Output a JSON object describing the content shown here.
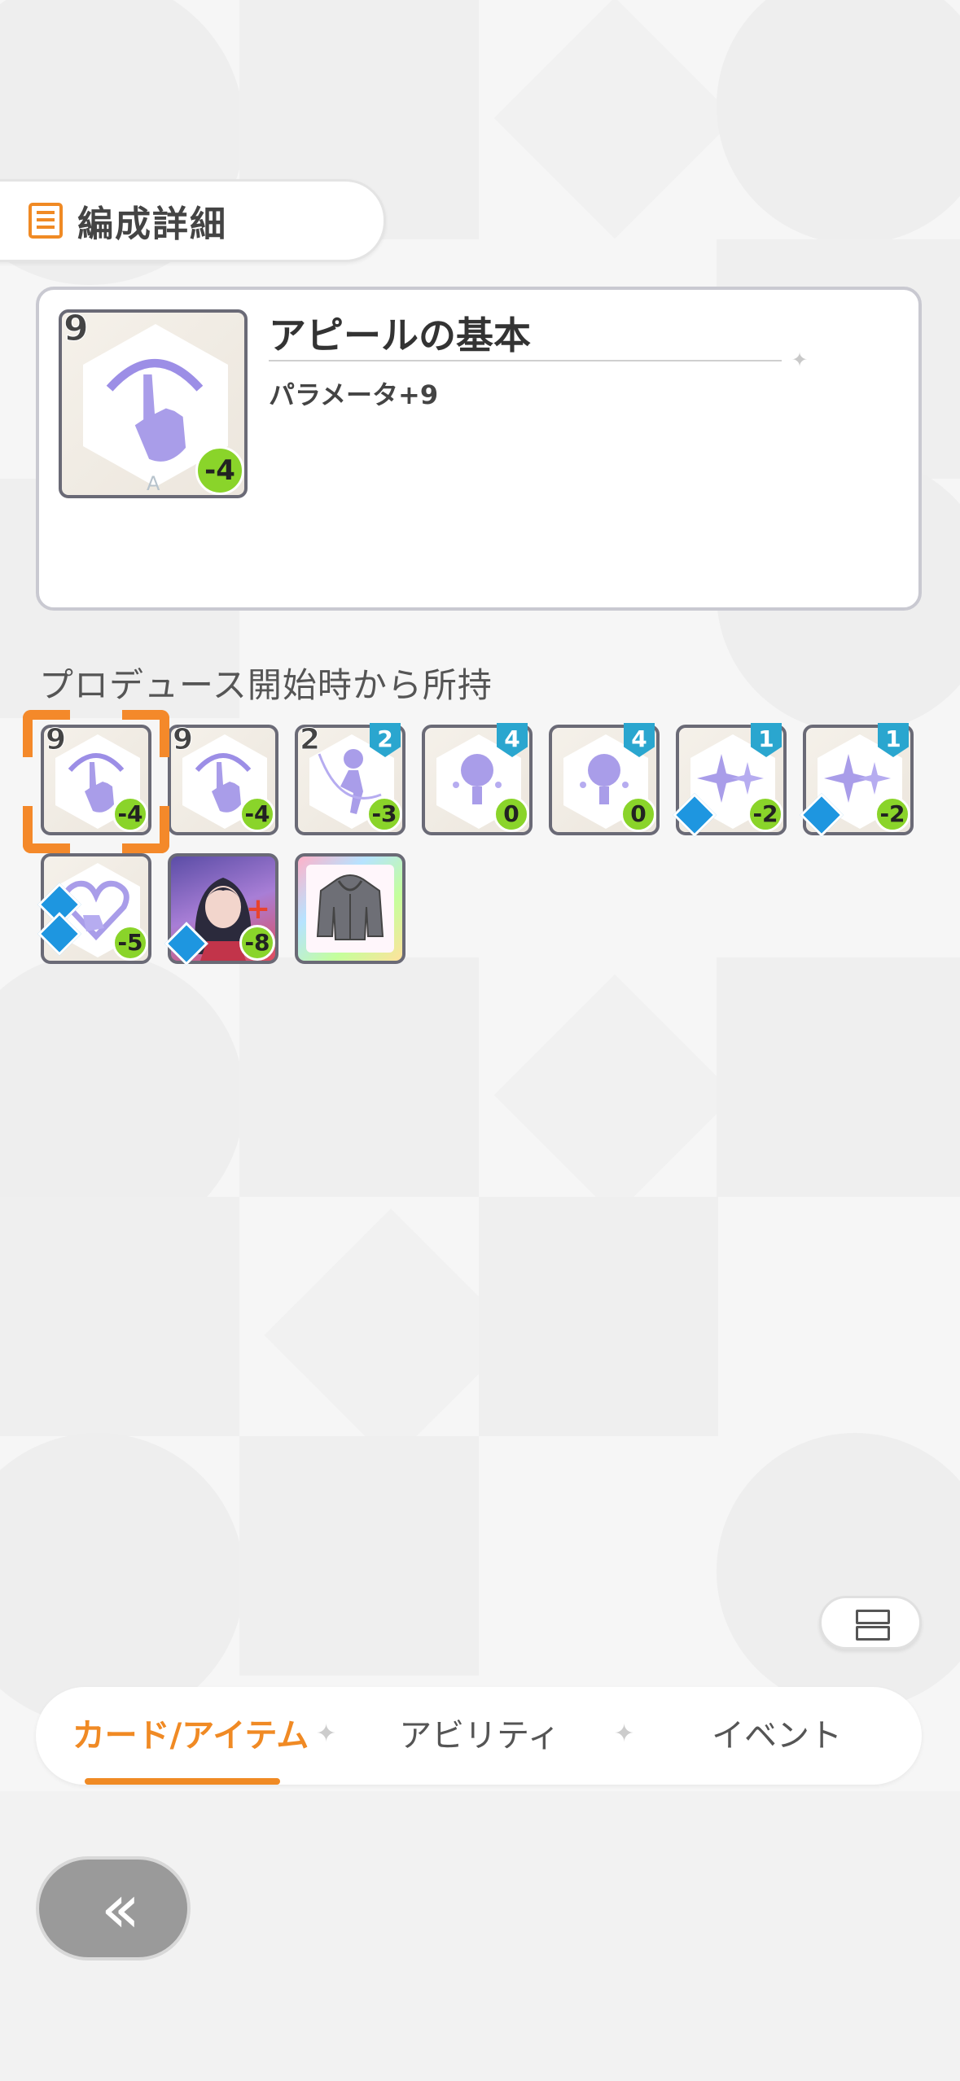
{
  "header": {
    "title": "編成詳細",
    "icon": "list-icon"
  },
  "detail": {
    "card_name": "アピールの基本",
    "effect": "パラメータ+9",
    "level": "9",
    "cost": "-4",
    "rank": "A"
  },
  "section_title": "プロデュース開始時から所持",
  "cards": [
    {
      "level": "9",
      "cost": "-4",
      "art": "pointing-hand-icon"
    },
    {
      "level": "9",
      "cost": "-4",
      "art": "pointing-hand-icon"
    },
    {
      "level": "2",
      "shield": "2",
      "cost": "-3",
      "art": "jump-figure-icon"
    },
    {
      "shield": "4",
      "cost": "0",
      "art": "lightbulb-icon"
    },
    {
      "shield": "4",
      "cost": "0",
      "art": "lightbulb-icon"
    },
    {
      "shield": "1",
      "cost": "-2",
      "art": "sparkle-icon"
    },
    {
      "shield": "1",
      "cost": "-2",
      "art": "sparkle-icon"
    },
    {
      "cost": "-5",
      "art": "heart-hand-icon"
    },
    {
      "cost": "-8",
      "art": "idol-portrait"
    },
    {
      "art": "hoodie-item-icon"
    }
  ],
  "tabs": [
    "カード/アイテム",
    "アビリティ",
    "イベント"
  ],
  "colors": {
    "accent": "#f08a24",
    "cost": "#8ad42a",
    "shield": "#2aa6cf"
  }
}
